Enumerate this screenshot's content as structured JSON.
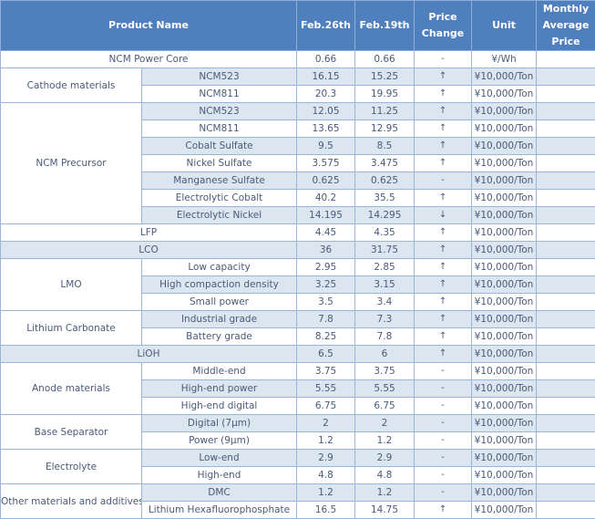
{
  "header": {
    "product_name": "Product Name",
    "feb26": "Feb.26th",
    "feb19": "Feb.19th",
    "price_change": "Price Change",
    "unit": "Unit",
    "monthly_avg": "Monthly Average Price"
  },
  "rows": [
    {
      "group": "NCM Power Core",
      "item": "",
      "feb26": "0.66",
      "feb19": "0.66",
      "change": "-",
      "unit": "¥/Wh",
      "monthly": ""
    },
    {
      "group": "Cathode materials",
      "item": "NCM523",
      "feb26": "16.15",
      "feb19": "15.25",
      "change": "↑",
      "unit": "¥10,000/Ton",
      "monthly": ""
    },
    {
      "group": "Cathode materials",
      "item": "NCM811",
      "feb26": "20.3",
      "feb19": "19.95",
      "change": "↑",
      "unit": "¥10,000/Ton",
      "monthly": ""
    },
    {
      "group": "NCM Precursor",
      "item": "NCM523",
      "feb26": "12.05",
      "feb19": "11.25",
      "change": "↑",
      "unit": "¥10,000/Ton",
      "monthly": ""
    },
    {
      "group": "NCM Precursor",
      "item": "NCM811",
      "feb26": "13.65",
      "feb19": "12.95",
      "change": "↑",
      "unit": "¥10,000/Ton",
      "monthly": ""
    },
    {
      "group": "NCM Precursor",
      "item": "Cobalt Sulfate",
      "feb26": "9.5",
      "feb19": "8.5",
      "change": "↑",
      "unit": "¥10,000/Ton",
      "monthly": ""
    },
    {
      "group": "NCM Precursor",
      "item": "Nickel Sulfate",
      "feb26": "3.575",
      "feb19": "3.475",
      "change": "↑",
      "unit": "¥10,000/Ton",
      "monthly": ""
    },
    {
      "group": "NCM Precursor",
      "item": "Manganese Sulfate",
      "feb26": "0.625",
      "feb19": "0.625",
      "change": "-",
      "unit": "¥10,000/Ton",
      "monthly": ""
    },
    {
      "group": "NCM Precursor",
      "item": "Electrolytic Cobalt",
      "feb26": "40.2",
      "feb19": "35.5",
      "change": "↑",
      "unit": "¥10,000/Ton",
      "monthly": ""
    },
    {
      "group": "NCM Precursor",
      "item": "Electrolytic Nickel",
      "feb26": "14.195",
      "feb19": "14.295",
      "change": "↓",
      "unit": "¥10,000/Ton",
      "monthly": ""
    },
    {
      "group": "LFP",
      "item": "",
      "feb26": "4.45",
      "feb19": "4.35",
      "change": "↑",
      "unit": "¥10,000/Ton",
      "monthly": ""
    },
    {
      "group": "LCO",
      "item": "",
      "feb26": "36",
      "feb19": "31.75",
      "change": "↑",
      "unit": "¥10,000/Ton",
      "monthly": ""
    },
    {
      "group": "LMO",
      "item": "Low capacity",
      "feb26": "2.95",
      "feb19": "2.85",
      "change": "↑",
      "unit": "¥10,000/Ton",
      "monthly": ""
    },
    {
      "group": "LMO",
      "item": "High compaction density",
      "feb26": "3.25",
      "feb19": "3.15",
      "change": "↑",
      "unit": "¥10,000/Ton",
      "monthly": ""
    },
    {
      "group": "LMO",
      "item": "Small power",
      "feb26": "3.5",
      "feb19": "3.4",
      "change": "↑",
      "unit": "¥10,000/Ton",
      "monthly": ""
    },
    {
      "group": "Lithium Carbonate",
      "item": "Industrial grade",
      "feb26": "7.8",
      "feb19": "7.3",
      "change": "↑",
      "unit": "¥10,000/Ton",
      "monthly": ""
    },
    {
      "group": "Lithium Carbonate",
      "item": "Battery grade",
      "feb26": "8.25",
      "feb19": "7.8",
      "change": "↑",
      "unit": "¥10,000/Ton",
      "monthly": ""
    },
    {
      "group": "LiOH",
      "item": "",
      "feb26": "6.5",
      "feb19": "6",
      "change": "↑",
      "unit": "¥10,000/Ton",
      "monthly": ""
    },
    {
      "group": "Anode materials",
      "item": "Middle-end",
      "feb26": "3.75",
      "feb19": "3.75",
      "change": "-",
      "unit": "¥10,000/Ton",
      "monthly": ""
    },
    {
      "group": "Anode materials",
      "item": "High-end power",
      "feb26": "5.55",
      "feb19": "5.55",
      "change": "-",
      "unit": "¥10,000/Ton",
      "monthly": ""
    },
    {
      "group": "Anode materials",
      "item": "High-end digital",
      "feb26": "6.75",
      "feb19": "6.75",
      "change": "-",
      "unit": "¥10,000/Ton",
      "monthly": ""
    },
    {
      "group": "Base Separator",
      "item": "Digital (7μm)",
      "feb26": "2",
      "feb19": "2",
      "change": "-",
      "unit": "¥10,000/Ton",
      "monthly": ""
    },
    {
      "group": "Base Separator",
      "item": "Power (9μm)",
      "feb26": "1.2",
      "feb19": "1.2",
      "change": "-",
      "unit": "¥10,000/Ton",
      "monthly": ""
    },
    {
      "group": "Electrolyte",
      "item": "Low-end",
      "feb26": "2.9",
      "feb19": "2.9",
      "change": "-",
      "unit": "¥10,000/Ton",
      "monthly": ""
    },
    {
      "group": "Electrolyte",
      "item": "High-end",
      "feb26": "4.8",
      "feb19": "4.8",
      "change": "-",
      "unit": "¥10,000/Ton",
      "monthly": ""
    },
    {
      "group": "Other materials and additives",
      "item": "DMC",
      "feb26": "1.2",
      "feb19": "1.2",
      "change": "-",
      "unit": "¥10,000/Ton",
      "monthly": ""
    },
    {
      "group": "Other materials and additives",
      "item": "Lithium Hexafluorophosphate",
      "feb26": "16.5",
      "feb19": "14.75",
      "change": "↑",
      "unit": "¥10,000/Ton",
      "monthly": ""
    }
  ]
}
